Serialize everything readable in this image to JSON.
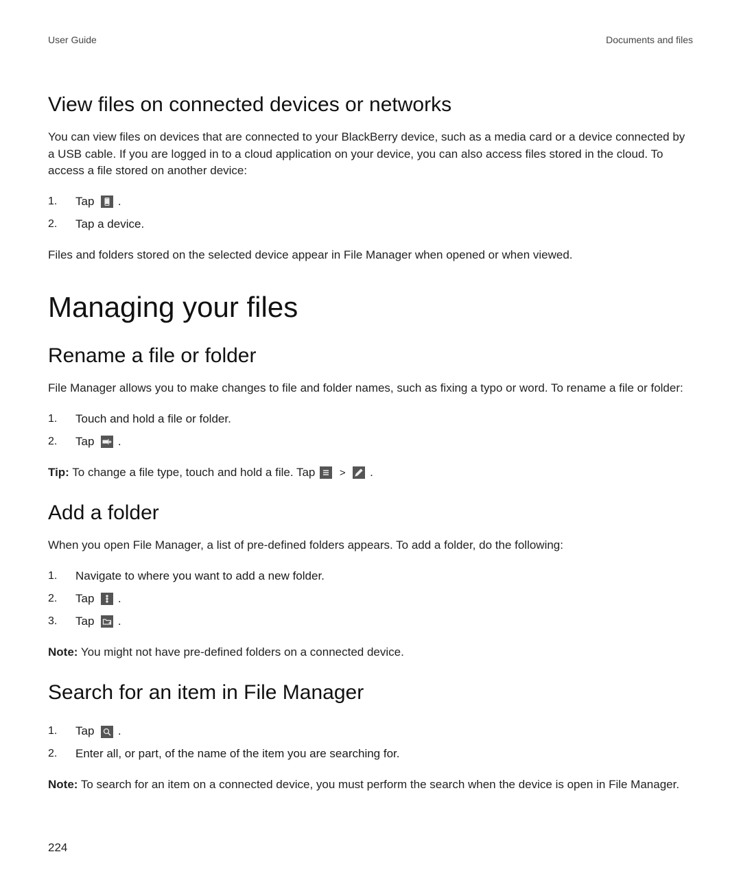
{
  "header": {
    "left": "User Guide",
    "right": "Documents and files"
  },
  "section1": {
    "title": "View files on connected devices or networks",
    "intro": "You can view files on devices that are connected to your BlackBerry device, such as a media card or a device connected by a USB cable. If you are logged in to a cloud application on your device, you can also access files stored in the cloud. To access a file stored on another device:",
    "steps": {
      "s1_tap": "Tap",
      "s1_period": ".",
      "s2": "Tap a device."
    },
    "outro": "Files and folders stored on the selected device appear in File Manager when opened or when viewed."
  },
  "mainTitle": "Managing your files",
  "section2": {
    "title": "Rename a file or folder",
    "intro": "File Manager allows you to make changes to file and folder names, such as fixing a typo or word. To rename a file or folder:",
    "steps": {
      "s1": "Touch and hold a file or folder.",
      "s2_tap": "Tap",
      "s2_period": "."
    },
    "tip_label": "Tip:",
    "tip_text1": " To change a file type, touch and hold a file. Tap",
    "tip_gt": ">",
    "tip_period": "."
  },
  "section3": {
    "title": "Add a folder",
    "intro": "When you open File Manager, a list of pre-defined folders appears. To add a folder, do the following:",
    "steps": {
      "s1": "Navigate to where you want to add a new folder.",
      "s2_tap": "Tap",
      "s2_period": ".",
      "s3_tap": "Tap",
      "s3_period": "."
    },
    "note_label": "Note:",
    "note_text": " You might not have pre-defined folders on a connected device."
  },
  "section4": {
    "title": "Search for an item in File Manager",
    "steps": {
      "s1_tap": "Tap",
      "s1_period": ".",
      "s2": "Enter all, or part, of the name of the item you are searching for."
    },
    "note_label": "Note:",
    "note_text": " To search for an item on a connected device, you must perform the search when the device is open in File Manager."
  },
  "pageNumber": "224"
}
